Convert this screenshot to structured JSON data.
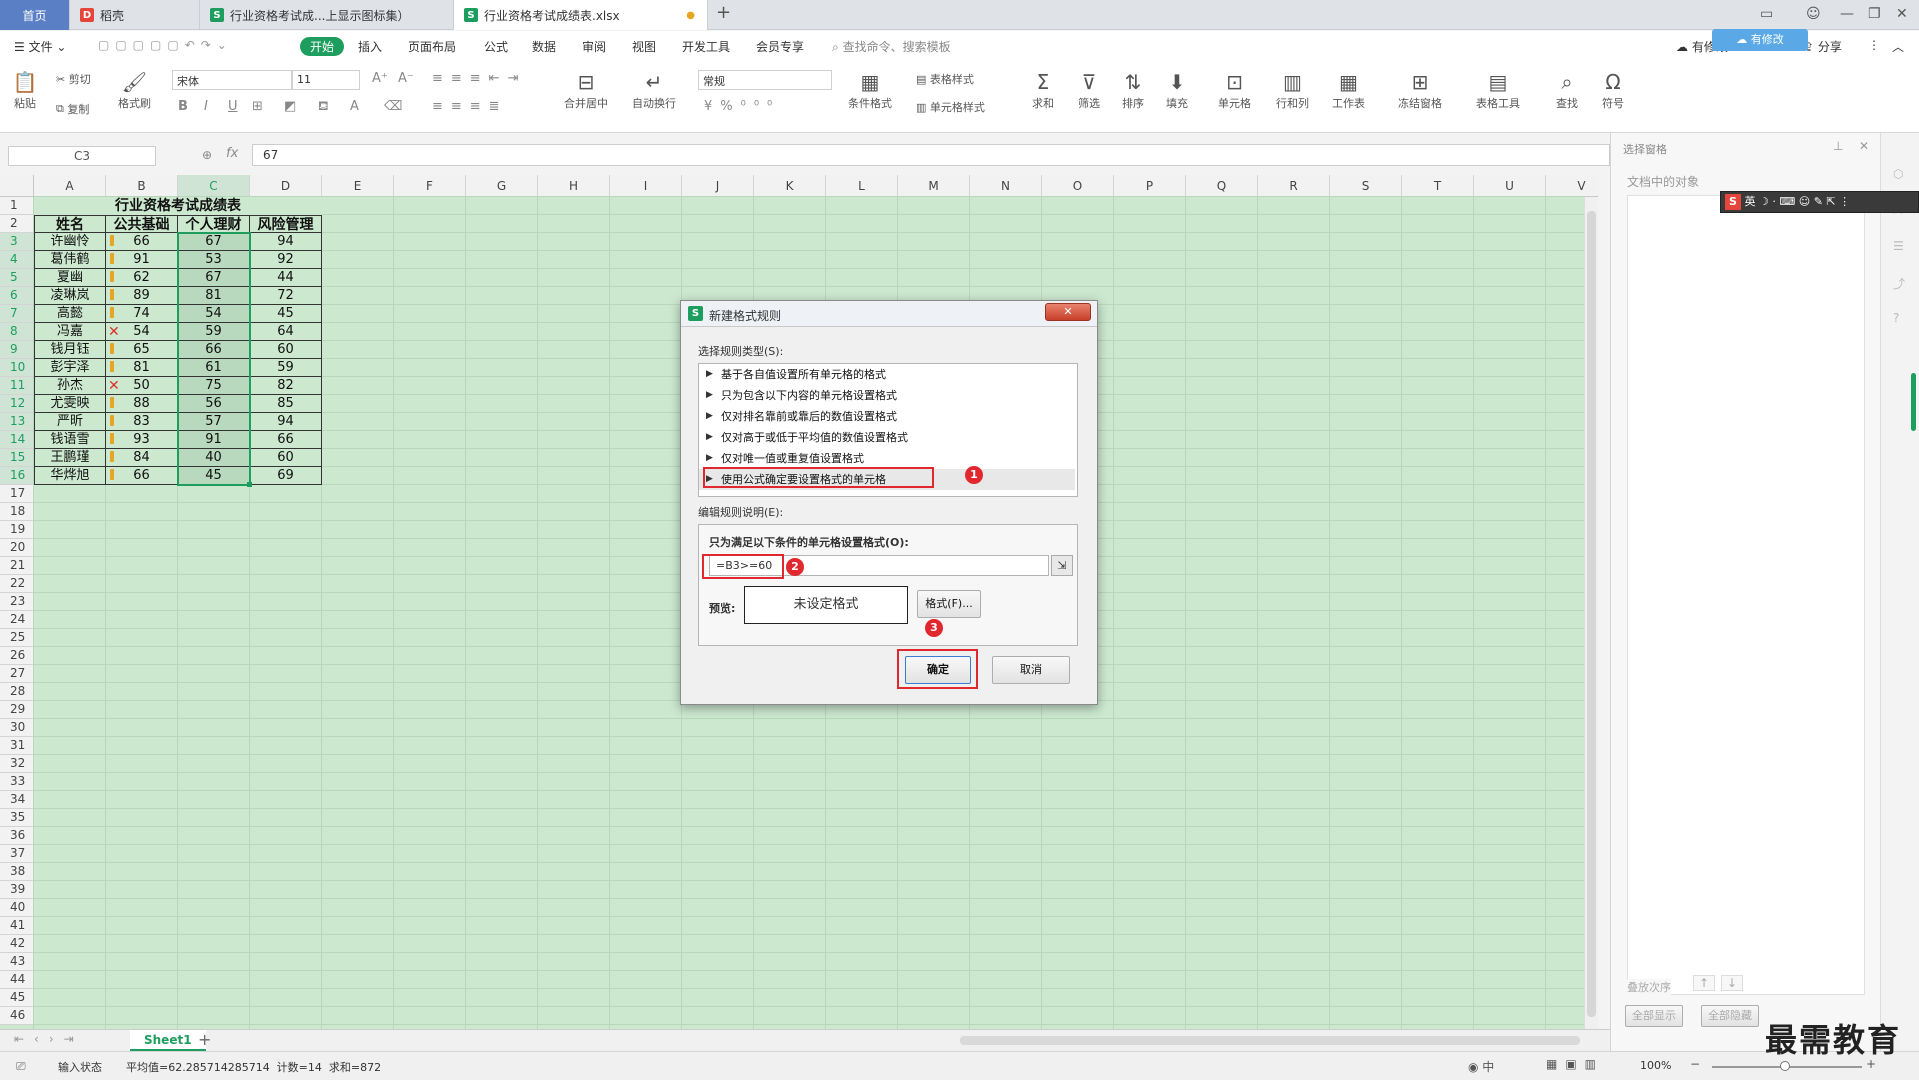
{
  "tabs": [
    {
      "label": "首页"
    },
    {
      "label": "稻壳"
    },
    {
      "label": "行业资格考试成...上显示图标集）"
    },
    {
      "label": "行业资格考试成绩表.xlsx"
    }
  ],
  "menu": {
    "file": "文件",
    "items": [
      "开始",
      "插入",
      "页面布局",
      "公式",
      "数据",
      "审阅",
      "视图",
      "开发工具",
      "会员专享"
    ],
    "search": "查找命令、搜索模板",
    "right": [
      "有修改",
      "分享"
    ],
    "cloud_tip": "有修改"
  },
  "ribbon": {
    "clipboard": {
      "paste": "粘贴",
      "cut": "剪切",
      "copy": "复制",
      "format_painter": "格式刷"
    },
    "font": {
      "name": "宋体",
      "size": "11"
    },
    "align": {
      "merge": "合并居中",
      "wrap": "自动换行"
    },
    "number": {
      "format": "常规"
    },
    "styles": {
      "cond_format": "条件格式",
      "table_style": "表格样式",
      "cell_style": "单元格样式"
    },
    "editing": {
      "sum": "求和",
      "filter": "筛选",
      "sort": "排序",
      "fill": "填充"
    },
    "cells": {
      "cell": "单元格",
      "rowcol": "行和列",
      "sheet": "工作表",
      "freeze": "冻结窗格",
      "table_tools": "表格工具",
      "find": "查找",
      "symbol": "符号"
    }
  },
  "formula": {
    "namebox": "C3",
    "fx": "fx",
    "value": "67"
  },
  "columns": [
    "A",
    "B",
    "C",
    "D",
    "E",
    "F",
    "G",
    "H",
    "I",
    "J",
    "K",
    "L",
    "M",
    "N",
    "O",
    "P",
    "Q",
    "R",
    "S",
    "T",
    "U",
    "V"
  ],
  "rows": [
    "1",
    "2",
    "3",
    "4",
    "5",
    "6",
    "7",
    "8",
    "9",
    "10",
    "11",
    "12",
    "13",
    "14",
    "15",
    "16",
    "17",
    "18",
    "19",
    "20",
    "21",
    "22",
    "23",
    "24",
    "25",
    "26",
    "27",
    "28",
    "29",
    "30",
    "31",
    "32",
    "33",
    "34",
    "35",
    "36",
    "37",
    "38",
    "39",
    "40",
    "41",
    "42",
    "43",
    "44",
    "45",
    "46"
  ],
  "table": {
    "title": "行业资格考试成绩表",
    "headers": [
      "姓名",
      "公共基础",
      "个人理财",
      "风险管理"
    ],
    "records": [
      {
        "name": "许幽怜",
        "b": "66",
        "c": "67",
        "d": "94",
        "icon": "warn"
      },
      {
        "name": "葛伟鹤",
        "b": "91",
        "c": "53",
        "d": "92",
        "icon": "warn"
      },
      {
        "name": "夏幽",
        "b": "62",
        "c": "67",
        "d": "44",
        "icon": "warn"
      },
      {
        "name": "凌琳岚",
        "b": "89",
        "c": "81",
        "d": "72",
        "icon": "warn"
      },
      {
        "name": "高懿",
        "b": "74",
        "c": "54",
        "d": "45",
        "icon": "warn"
      },
      {
        "name": "冯嘉",
        "b": "54",
        "c": "59",
        "d": "64",
        "icon": "cross"
      },
      {
        "name": "钱月钰",
        "b": "65",
        "c": "66",
        "d": "60",
        "icon": "warn"
      },
      {
        "name": "彭宇泽",
        "b": "81",
        "c": "61",
        "d": "59",
        "icon": "warn"
      },
      {
        "name": "孙杰",
        "b": "50",
        "c": "75",
        "d": "82",
        "icon": "cross"
      },
      {
        "name": "尤雯映",
        "b": "88",
        "c": "56",
        "d": "85",
        "icon": "warn"
      },
      {
        "name": "严昕",
        "b": "83",
        "c": "57",
        "d": "94",
        "icon": "warn"
      },
      {
        "name": "钱语雪",
        "b": "93",
        "c": "91",
        "d": "66",
        "icon": "warn"
      },
      {
        "name": "王鹏瑾",
        "b": "84",
        "c": "40",
        "d": "60",
        "icon": "warn"
      },
      {
        "name": "华烨旭",
        "b": "66",
        "c": "45",
        "d": "69",
        "icon": "warn"
      }
    ]
  },
  "dialog": {
    "title": "新建格式规则",
    "type_label": "选择规则类型(S):",
    "rules": [
      "基于各自值设置所有单元格的格式",
      "只为包含以下内容的单元格设置格式",
      "仅对排名靠前或靠后的数值设置格式",
      "仅对高于或低于平均值的数值设置格式",
      "仅对唯一值或重复值设置格式",
      "使用公式确定要设置格式的单元格"
    ],
    "desc_label": "编辑规则说明(E):",
    "formula_label": "只为满足以下条件的单元格设置格式(O):",
    "formula": "=B3>=60",
    "preview_label": "预览:",
    "preview_text": "未设定格式",
    "format_btn": "格式(F)...",
    "ok": "确定",
    "cancel": "取消",
    "badges": [
      "1",
      "2",
      "3"
    ]
  },
  "panel": {
    "title": "选择窗格",
    "subtitle": "文档中的对象",
    "order": "叠放次序",
    "show_all": "全部显示",
    "hide_all": "全部隐藏"
  },
  "ime": {
    "s": "S",
    "lang": "英"
  },
  "sheet_tab": "Sheet1",
  "status": {
    "mode": "输入状态",
    "stats": "平均值=62.285714285714  计数=14  求和=872",
    "zoom": "100%"
  },
  "watermark": "最需教育",
  "colors": {
    "accent": "#1e9e5e",
    "sheet_bg": "#cce8cf",
    "red": "#e0282e",
    "warn": "#e8a524"
  }
}
